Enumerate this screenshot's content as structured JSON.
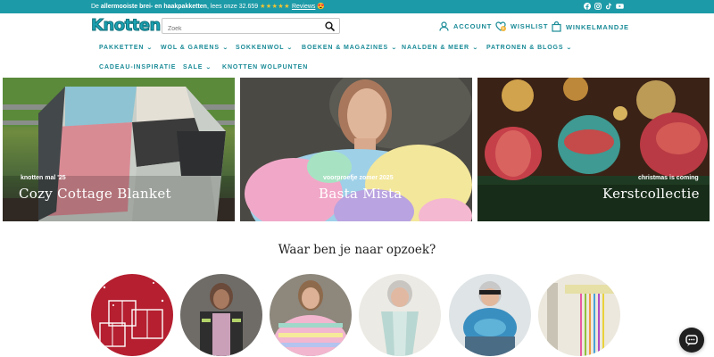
{
  "announcement": {
    "prefix": "De ",
    "bold": "allermooiste brei- en haakpakketten",
    "middle": ", lees onze 32.659 ",
    "stars": "★★★★★",
    "reviews_link": "Reviews",
    "emoji": "😍"
  },
  "socials": [
    "facebook-icon",
    "instagram-icon",
    "tiktok-icon",
    "youtube-icon"
  ],
  "header": {
    "logo": "Knotten",
    "search_placeholder": "Zoek",
    "account": "ACCOUNT",
    "wishlist": "WISHLIST",
    "wishlist_count": "0",
    "cart": "WINKELMANDJE"
  },
  "nav": {
    "items": [
      {
        "label": "PAKKETTEN",
        "chevron": true
      },
      {
        "label": "WOL & GARENS",
        "chevron": true
      },
      {
        "label": "SOKKENWOL",
        "chevron": true
      },
      {
        "label": "BOEKEN & MAGAZINES",
        "chevron": true
      },
      {
        "label": "NAALDEN & MEER",
        "chevron": true
      },
      {
        "label": "PATRONEN & BLOGS",
        "chevron": true
      },
      {
        "label": "CADEAU-INSPIRATIE",
        "chevron": false
      },
      {
        "label": "SALE",
        "chevron": true
      },
      {
        "label": "KNOTTEN WOLPUNTEN",
        "chevron": false
      }
    ]
  },
  "heroes": [
    {
      "kicker": "knotten mal '25",
      "title": "Cozy Cottage Blanket"
    },
    {
      "kicker": "voorproefje zomer 2025",
      "title": "Basta Mista"
    },
    {
      "kicker": "christmas is coming",
      "title": "Kerstcollectie"
    }
  ],
  "section": {
    "title": "Waar ben je naar opzoek?"
  },
  "categories": [
    {
      "name": "category-gifts"
    },
    {
      "name": "category-vest"
    },
    {
      "name": "category-sweater"
    },
    {
      "name": "category-shawl"
    },
    {
      "name": "category-cowl"
    },
    {
      "name": "category-needles"
    }
  ],
  "colors": {
    "brand": "#1d9aa7",
    "nav_text": "#1a8b97",
    "stars": "#f7c531"
  }
}
